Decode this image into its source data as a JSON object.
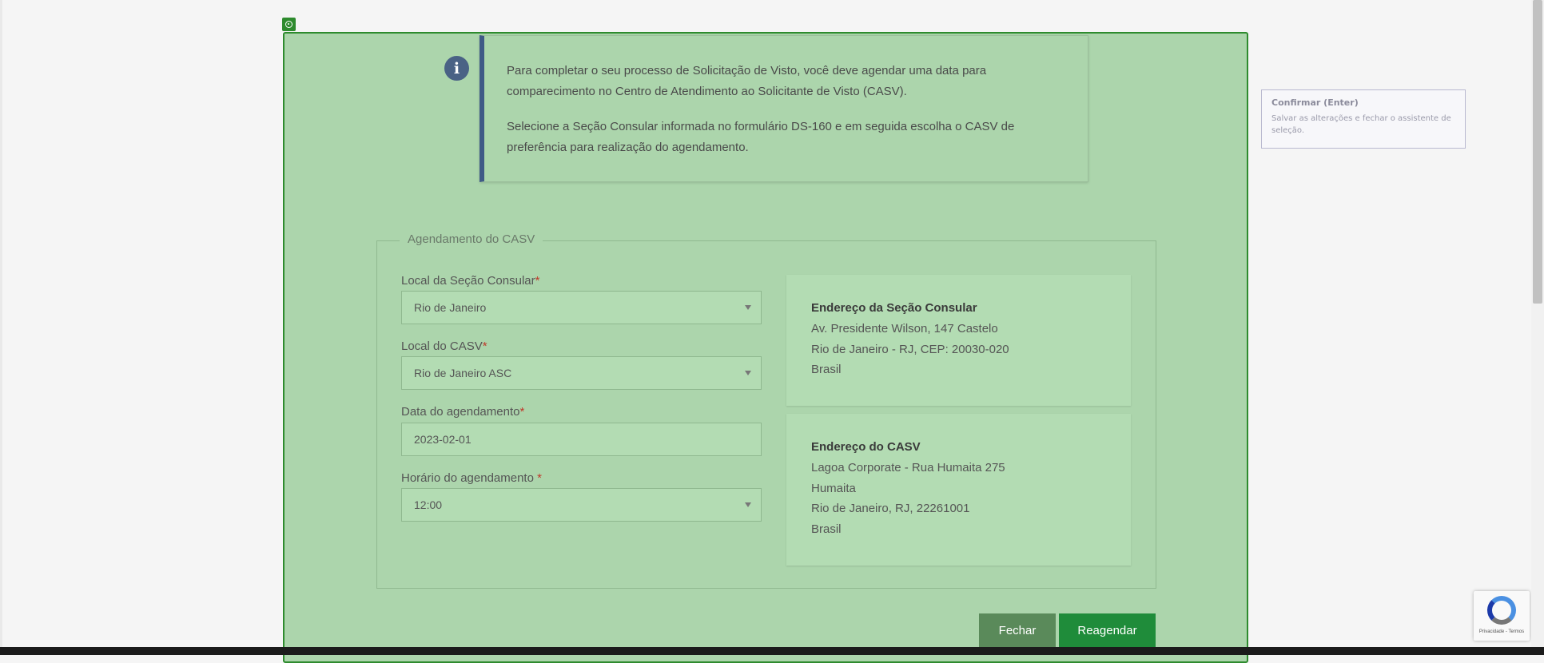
{
  "info": {
    "paragraph1": "Para completar o seu processo de Solicitação de Visto, você deve agendar uma data para comparecimento no Centro de Atendimento ao Solicitante de Visto (CASV).",
    "paragraph2": "Selecione a Seção Consular informada no formulário DS-160 e em seguida escolha o CASV de preferência para realização do agendamento."
  },
  "form": {
    "legend": "Agendamento do CASV",
    "consular_label": "Local da Seção Consular",
    "consular_value": "Rio de Janeiro",
    "casv_label": "Local do CASV",
    "casv_value": "Rio de Janeiro ASC",
    "date_label": "Data do agendamento",
    "date_value": "2023-02-01",
    "time_label": "Horário do agendamento ",
    "time_value": "12:00",
    "required_mark": "*"
  },
  "consular_address": {
    "title": "Endereço da Seção Consular",
    "lines": [
      "Av. Presidente Wilson, 147 Castelo",
      "Rio de Janeiro - RJ, CEP: 20030-020",
      "Brasil"
    ]
  },
  "casv_address": {
    "title": "Endereço do CASV",
    "lines": [
      "Lagoa Corporate - Rua Humaita 275",
      "Humaita",
      "Rio de Janeiro, RJ, 22261001",
      "Brasil"
    ]
  },
  "buttons": {
    "close": "Fechar",
    "reschedule": "Reagendar"
  },
  "tooltip": {
    "title": "Confirmar (Enter)",
    "description": "Salvar as alterações e fechar o assistente de seleção."
  },
  "recaptcha": {
    "text": "Privacidade - Termos"
  },
  "colors": {
    "highlight": "#2e8b2e",
    "panel": "#acd5ac",
    "primary_button": "#1f8c3a",
    "info_accent": "#3f5a86"
  }
}
